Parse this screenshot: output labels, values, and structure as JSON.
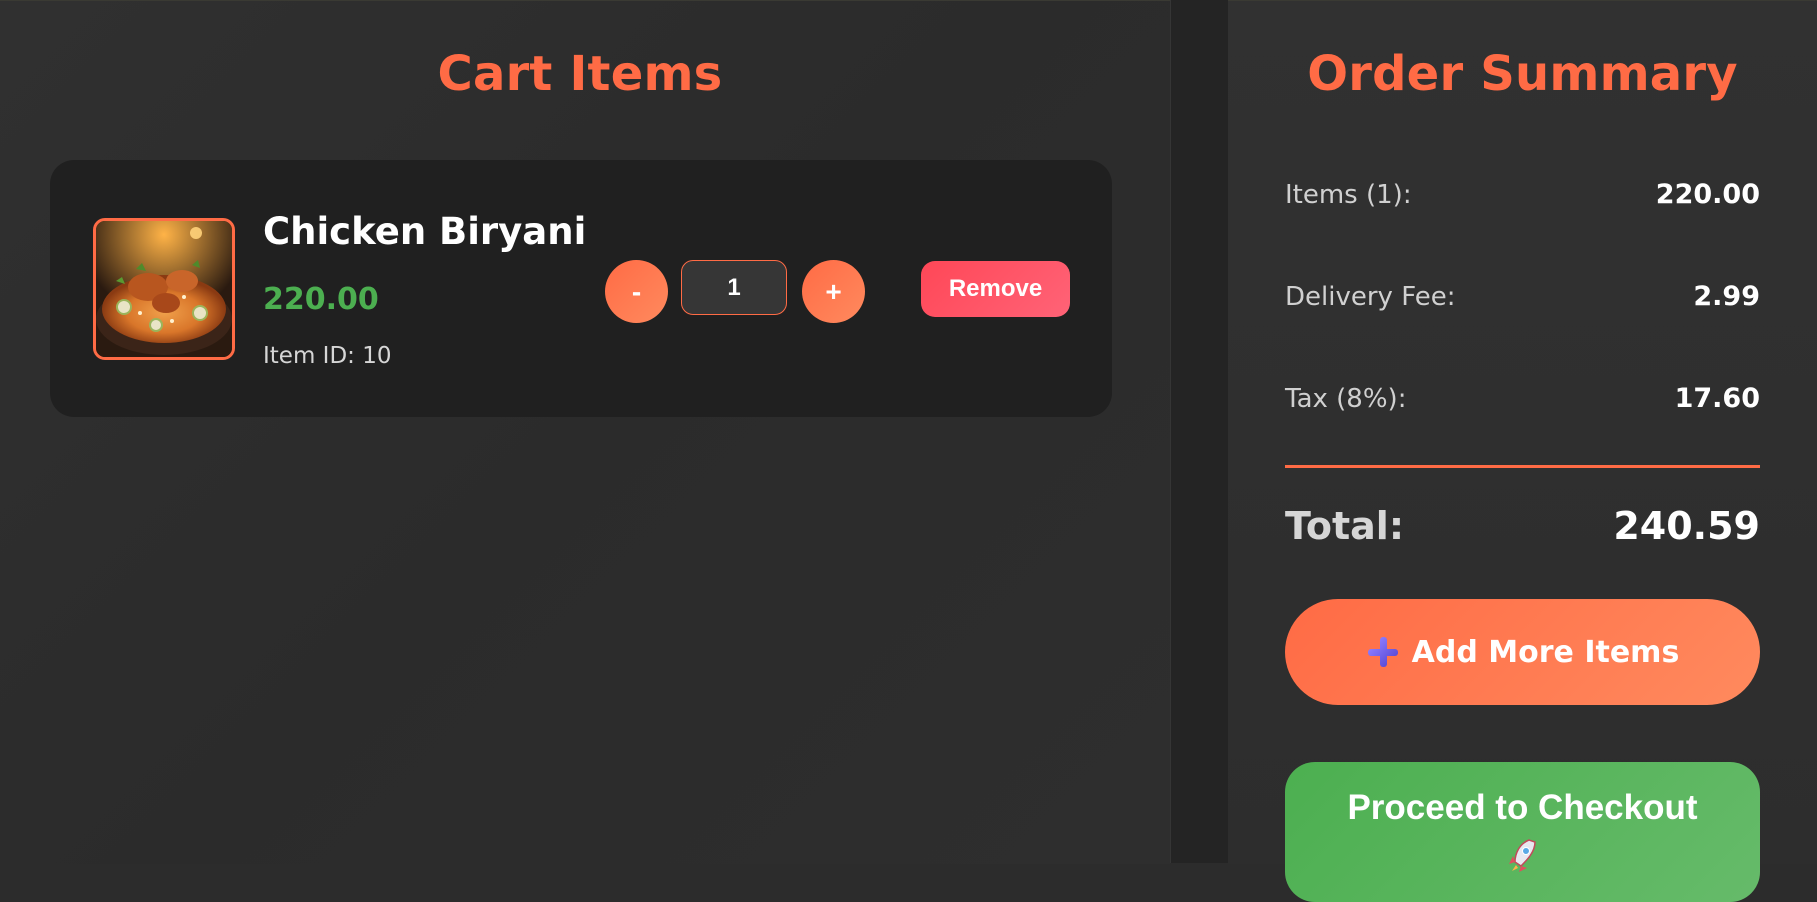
{
  "cart": {
    "title": "Cart Items",
    "items": [
      {
        "name": "Chicken Biryani",
        "price": "220.00",
        "item_id": "Item ID: 10",
        "quantity": "1",
        "decrement_label": "-",
        "increment_label": "+",
        "remove_label": "Remove"
      }
    ]
  },
  "summary": {
    "title": "Order Summary",
    "items_label": "Items (1):",
    "items_value": "220.00",
    "delivery_label": "Delivery Fee:",
    "delivery_value": "2.99",
    "tax_label": "Tax (8%):",
    "tax_value": "17.60",
    "total_label": "Total:",
    "total_value": "240.59",
    "add_more_label": "Add More Items",
    "add_more_icon": "plus-icon",
    "checkout_label": "Proceed to Checkout",
    "checkout_icon": "rocket-icon"
  },
  "colors": {
    "accent": "#ff6b45",
    "price_green": "#4caf50",
    "remove_red": "#ff4757",
    "checkout_green": "#4caf50",
    "background": "#2c2c2c",
    "card": "#202020"
  }
}
